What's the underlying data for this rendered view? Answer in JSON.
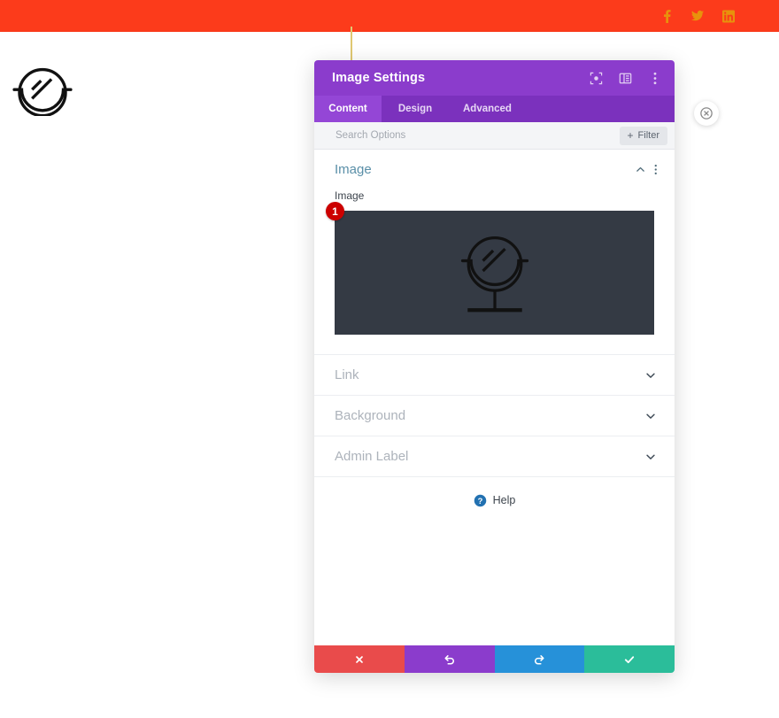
{
  "page": {
    "background_color": "#ffffff",
    "top_bar": {
      "background_color": "#fc3b1b",
      "social_links": [
        {
          "name": "facebook-icon",
          "label": "Facebook"
        },
        {
          "name": "twitter-icon",
          "label": "Twitter"
        },
        {
          "name": "linkedin-icon",
          "label": "LinkedIn"
        }
      ]
    },
    "logo": {
      "name": "mirror-logo",
      "alt": "Table mirror logo"
    },
    "connector_line_color": "#e0c872"
  },
  "modal": {
    "title": "Image Settings",
    "header_color": "#8b3ccc",
    "header_actions": [
      {
        "name": "focus-icon",
        "label": "Focus"
      },
      {
        "name": "panel-layout-icon",
        "label": "Layout"
      },
      {
        "name": "vertical-dots-icon",
        "label": "More options"
      }
    ],
    "close_button_label": "Close",
    "tabs": [
      {
        "label": "Content",
        "active": true
      },
      {
        "label": "Design",
        "active": false
      },
      {
        "label": "Advanced",
        "active": false
      }
    ],
    "search": {
      "placeholder": "Search Options",
      "value": ""
    },
    "filter_button": {
      "label": "Filter",
      "plus": "+"
    },
    "sections": [
      {
        "title": "Image",
        "open": true,
        "accent_color": "#5a8fa8",
        "field_label": "Image",
        "step_badge": "1",
        "preview_background": "#343a44"
      },
      {
        "title": "Link",
        "open": false
      },
      {
        "title": "Background",
        "open": false
      },
      {
        "title": "Admin Label",
        "open": false
      }
    ],
    "help": {
      "label": "Help",
      "icon": "question-circle-icon",
      "icon_color": "#2271b1"
    },
    "footer_buttons": [
      {
        "name": "cancel-button",
        "icon": "close-icon",
        "color": "#e94b4b",
        "label": "Cancel"
      },
      {
        "name": "undo-button",
        "icon": "undo-icon",
        "color": "#8b3ccc",
        "label": "Undo"
      },
      {
        "name": "redo-button",
        "icon": "redo-icon",
        "color": "#2691d9",
        "label": "Redo"
      },
      {
        "name": "save-button",
        "icon": "check-icon",
        "color": "#2bbd9a",
        "label": "Save"
      }
    ]
  }
}
